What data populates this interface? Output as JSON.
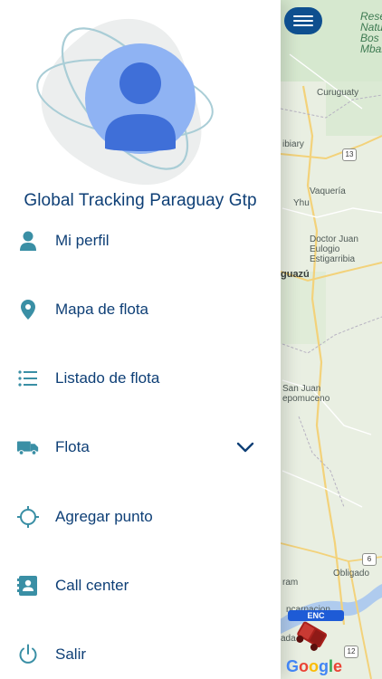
{
  "drawer": {
    "company_name": "Global Tracking Paraguay Gtp",
    "items": [
      {
        "label": "Mi perfil",
        "icon": "person-icon"
      },
      {
        "label": "Mapa de flota",
        "icon": "location-pin-icon"
      },
      {
        "label": "Listado de flota",
        "icon": "list-icon"
      },
      {
        "label": "Flota",
        "icon": "truck-icon",
        "expandable": true
      },
      {
        "label": "Agregar punto",
        "icon": "crosshair-icon"
      },
      {
        "label": "Call center",
        "icon": "contact-card-icon"
      },
      {
        "label": "Salir",
        "icon": "power-icon"
      }
    ]
  },
  "map": {
    "labels": {
      "reserva": "Rese\nNatur\nBos\nMbara",
      "curuguaty": "Curuguaty",
      "ibiary": "ibiary",
      "vaqueria": "Vaquería",
      "yhu": "Yhu",
      "doctor_juan": "Doctor Juan\nEulogio\nEstigarribia",
      "guazu": "guazú",
      "san_juan": "San Juan\nepomuceno",
      "obligado": "Obligado",
      "ram": "ram",
      "encarnacion": "ncarnacion",
      "ada": "ada"
    },
    "routes": {
      "r13": "13",
      "r6": "6",
      "r12": "12"
    },
    "vehicle_tag": "ENC",
    "google_logo": [
      "G",
      "o",
      "o",
      "g",
      "l",
      "e"
    ]
  },
  "colors": {
    "primary": "#0e3f76",
    "menu_button": "#0e4f8f",
    "icon_teal": "#3a8fa5",
    "avatar_blue": "#3f6fd8",
    "avatar_light": "#8fb3f3",
    "map_land": "#e9efe2"
  }
}
